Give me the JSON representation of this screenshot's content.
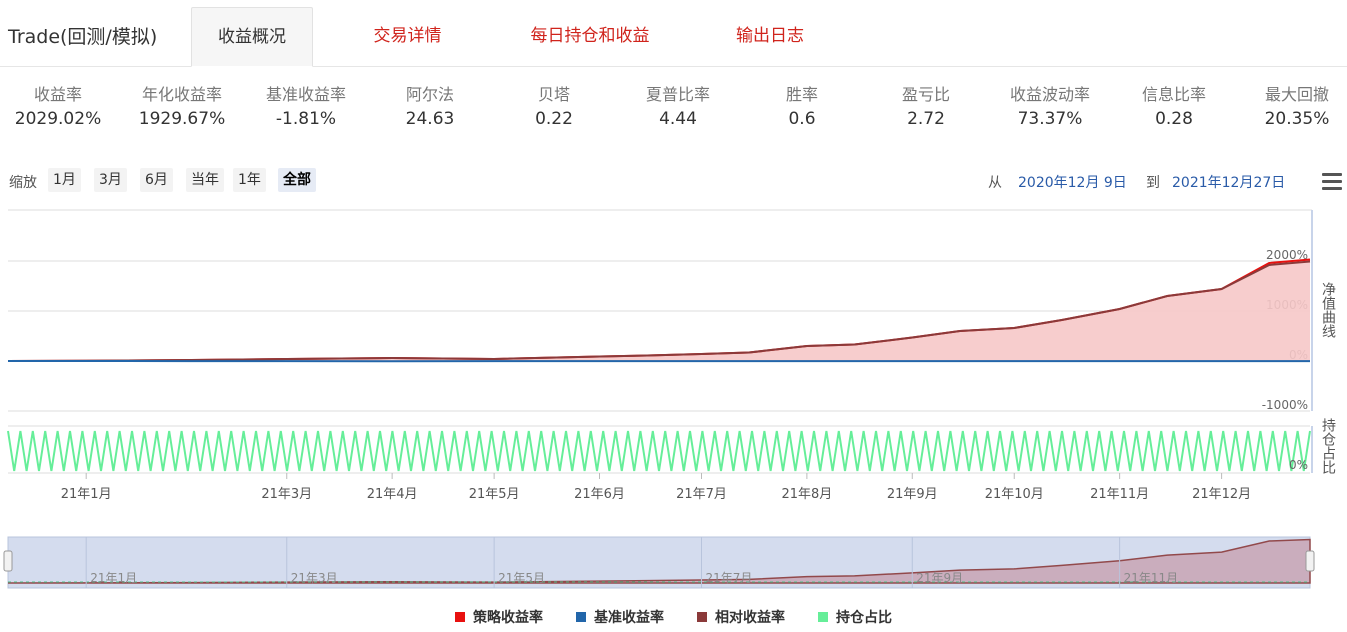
{
  "header": {
    "title": "Trade(回测/模拟)",
    "tabs": [
      {
        "label": "收益概况",
        "active": true
      },
      {
        "label": "交易详情",
        "active": false
      },
      {
        "label": "每日持仓和收益",
        "active": false
      },
      {
        "label": "输出日志",
        "active": false
      }
    ]
  },
  "metrics": [
    {
      "label": "收益率",
      "value": "2029.02%"
    },
    {
      "label": "年化收益率",
      "value": "1929.67%"
    },
    {
      "label": "基准收益率",
      "value": "-1.81%"
    },
    {
      "label": "阿尔法",
      "value": "24.63"
    },
    {
      "label": "贝塔",
      "value": "0.22"
    },
    {
      "label": "夏普比率",
      "value": "4.44"
    },
    {
      "label": "胜率",
      "value": "0.6"
    },
    {
      "label": "盈亏比",
      "value": "2.72"
    },
    {
      "label": "收益波动率",
      "value": "73.37%"
    },
    {
      "label": "信息比率",
      "value": "0.28"
    },
    {
      "label": "最大回撤",
      "value": "20.35%"
    }
  ],
  "zoom": {
    "label": "缩放",
    "buttons": [
      "1月",
      "3月",
      "6月",
      "当年",
      "1年",
      "全部"
    ],
    "selected": "全部",
    "from_label": "从",
    "from": "2020年12月 9日",
    "to_label": "到",
    "to": "2021年12月27日"
  },
  "icons": {
    "menu": "hamburger-menu-icon"
  },
  "colors": {
    "strategy": "#e8110f",
    "benchmark": "#2266aa",
    "relative": "#8b3a3a",
    "position": "#66ee99",
    "area_fill": "#f6c8c8",
    "accent_tab": "#d0241c"
  },
  "chart_data": {
    "type": "line",
    "title": "",
    "panels": [
      {
        "name": "净值曲线",
        "ylim": [
          -1000,
          2200
        ],
        "yticks": [
          "2000%",
          "1000%",
          "0%",
          "-1000%"
        ]
      },
      {
        "name": "持仓占比",
        "yticks": [
          "0%"
        ]
      }
    ],
    "x_ticks": [
      "21年1月",
      "21年3月",
      "21年4月",
      "21年5月",
      "21年6月",
      "21年7月",
      "21年8月",
      "21年9月",
      "21年10月",
      "21年11月",
      "21年12月"
    ],
    "navigator_ticks": [
      "21年1月",
      "21年3月",
      "21年5月",
      "21年7月",
      "21年9月",
      "21年11月"
    ],
    "x": [
      "2020-12-09",
      "2021-01-01",
      "2021-02-01",
      "2021-03-01",
      "2021-04-01",
      "2021-05-01",
      "2021-06-01",
      "2021-06-15",
      "2021-07-01",
      "2021-07-15",
      "2021-08-01",
      "2021-08-15",
      "2021-09-01",
      "2021-09-15",
      "2021-10-01",
      "2021-10-15",
      "2021-11-01",
      "2021-11-15",
      "2021-12-01",
      "2021-12-15",
      "2021-12-27"
    ],
    "series": [
      {
        "name": "策略收益率",
        "values": [
          0,
          5,
          20,
          40,
          60,
          40,
          90,
          110,
          140,
          170,
          300,
          330,
          470,
          600,
          660,
          820,
          1040,
          1300,
          1440,
          1960,
          2029
        ]
      },
      {
        "name": "基准收益率",
        "values": [
          0,
          0,
          -1,
          -2,
          -3,
          -2,
          -1,
          -1,
          -2,
          -2,
          -2,
          -2,
          -2,
          -2,
          -2,
          -2,
          -2,
          -2,
          -2,
          -2,
          -1.81
        ]
      },
      {
        "name": "相对收益率",
        "values": [
          0,
          5,
          20,
          40,
          60,
          40,
          90,
          110,
          140,
          170,
          300,
          330,
          470,
          600,
          660,
          820,
          1040,
          1300,
          1440,
          1920,
          1990
        ]
      }
    ],
    "position_series": {
      "name": "持仓占比",
      "pattern": "daily alternating 0%/100%"
    },
    "legend": {
      "position": "bottom",
      "items": [
        "策略收益率",
        "基准收益率",
        "相对收益率",
        "持仓占比"
      ]
    }
  }
}
